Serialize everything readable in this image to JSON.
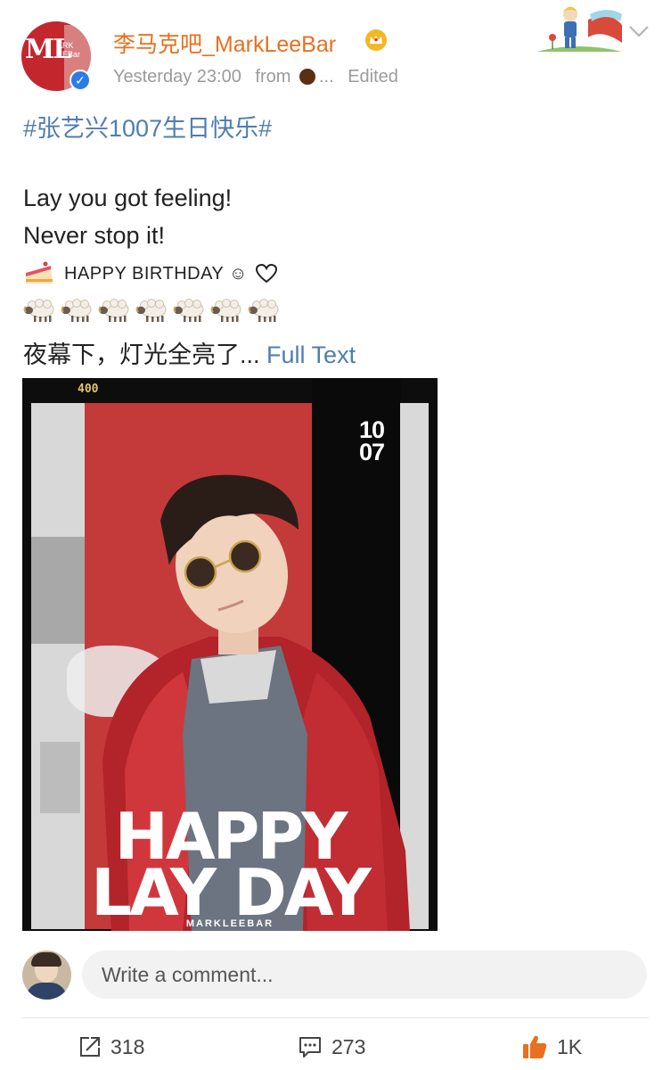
{
  "post": {
    "username": "李马克吧_MarkLeeBar",
    "meta": {
      "time": "Yesterday 23:00",
      "source_prefix": "from",
      "source_suffix": "...",
      "edited": "Edited"
    },
    "hashtag": "#张艺兴1007生日快乐#",
    "lines": [
      "Lay  you got feeling!",
      "Never stop it!"
    ],
    "birthday_text": "HAPPY BIRTHDAY ☺︎",
    "sheep_count": 7,
    "truncated_text": "夜幕下，灯光全亮了...",
    "full_text_link": "Full Text",
    "image": {
      "counter": "400",
      "date_line1": "10",
      "date_line2": "07",
      "title_line1": "HAPPY",
      "title_line2": "LAY DAY",
      "brand": "MARKLEEBAR"
    }
  },
  "comment": {
    "placeholder": "Write a comment..."
  },
  "actions": {
    "repost_count": "318",
    "comment_count": "273",
    "like_count": "1K"
  },
  "colors": {
    "username": "#e8701e",
    "link": "#4f7db2",
    "verified": "#2c7ce6",
    "like": "#e8701e"
  },
  "icons": [
    "crown-icon",
    "verified-icon",
    "chevron-down-icon",
    "cake-icon",
    "heart-icon",
    "sheep-icon",
    "repost-icon",
    "comment-icon",
    "like-icon"
  ]
}
